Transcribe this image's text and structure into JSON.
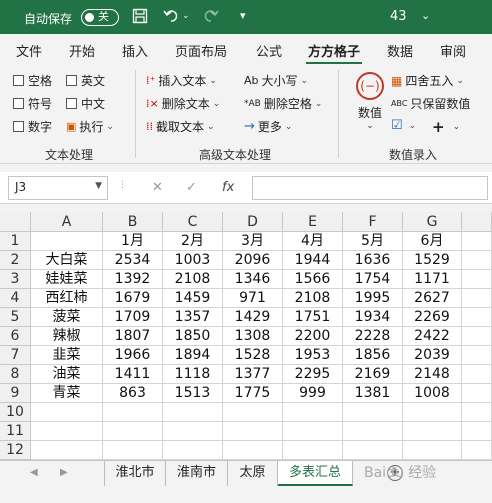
{
  "titlebar": {
    "autosave_label": "自动保存",
    "autosave_state": "关",
    "doc_name": "43",
    "doc_arrow": "⌄",
    "icons": [
      "save-icon",
      "undo-icon",
      "redo-icon",
      "customize-qat-icon"
    ],
    "bg_color": "#217346"
  },
  "tabs": [
    "文件",
    "开始",
    "插入",
    "页面布局",
    "公式",
    "方方格子",
    "数据",
    "审阅"
  ],
  "active_tab": "方方格子",
  "ribbon": {
    "text_group": {
      "checkboxes": [
        "空格",
        "英文",
        "符号",
        "中文",
        "数字"
      ],
      "execute": "执行",
      "label": "文本处理"
    },
    "advanced_group": {
      "items": [
        "插入文本",
        "大小写",
        "删除文本",
        "删除空格",
        "截取文本",
        "更多"
      ],
      "label": "高级文本处理"
    },
    "numeric_group": {
      "big_button": "数值",
      "items": [
        "四舍五入",
        "只保留数值"
      ],
      "label": "数值录入"
    }
  },
  "formula_bar": {
    "name_box": "J3",
    "fx": "fx",
    "value": ""
  },
  "sheet": {
    "columns": [
      "A",
      "B",
      "C",
      "D",
      "E",
      "F",
      "G"
    ],
    "rows": [
      [
        "",
        "1月",
        "2月",
        "3月",
        "4月",
        "5月",
        "6月"
      ],
      [
        "大白菜",
        "2534",
        "1003",
        "2096",
        "1944",
        "1636",
        "1529"
      ],
      [
        "娃娃菜",
        "1392",
        "2108",
        "1346",
        "1566",
        "1754",
        "1171"
      ],
      [
        "西红柿",
        "1679",
        "1459",
        "971",
        "2108",
        "1995",
        "2627"
      ],
      [
        "菠菜",
        "1709",
        "1357",
        "1429",
        "1751",
        "1934",
        "2269"
      ],
      [
        "辣椒",
        "1807",
        "1850",
        "1308",
        "2200",
        "2228",
        "2422"
      ],
      [
        "韭菜",
        "1966",
        "1894",
        "1528",
        "1953",
        "1856",
        "2039"
      ],
      [
        "油菜",
        "1411",
        "1118",
        "1377",
        "2295",
        "2169",
        "2148"
      ],
      [
        "青菜",
        "863",
        "1513",
        "1775",
        "999",
        "1381",
        "1008"
      ],
      [
        "",
        "",
        "",
        "",
        "",
        "",
        ""
      ],
      [
        "",
        "",
        "",
        "",
        "",
        "",
        ""
      ],
      [
        "",
        "",
        "",
        "",
        "",
        "",
        ""
      ]
    ],
    "row_numbers": [
      "1",
      "2",
      "3",
      "4",
      "5",
      "6",
      "7",
      "8",
      "9",
      "10",
      "11",
      "12"
    ]
  },
  "sheet_tabs": [
    "淮北市",
    "淮南市",
    "太原",
    "多表汇总"
  ],
  "active_sheet": "多表汇总",
  "watermark": "Baidu 经验"
}
